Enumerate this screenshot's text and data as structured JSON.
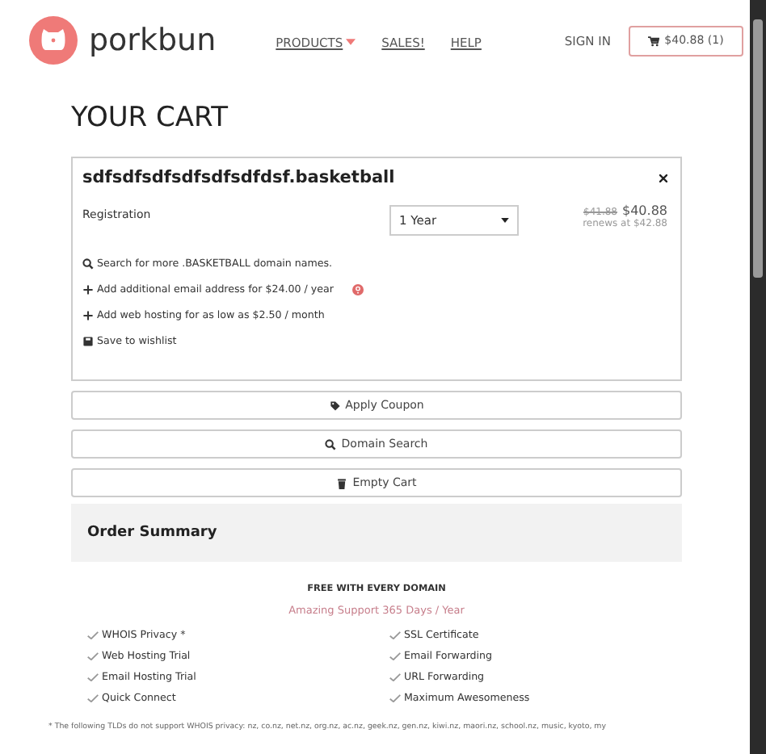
{
  "header": {
    "brand": "porkbun",
    "nav": [
      {
        "label": "PRODUCTS",
        "dropdown": true
      },
      {
        "label": "SALES!",
        "dropdown": false
      },
      {
        "label": "HELP",
        "dropdown": false
      }
    ],
    "sign_in": "SIGN IN",
    "cart_button": "$40.88 (1)"
  },
  "title": "YOUR CART",
  "cart_item": {
    "domain": "sdfsdfsdfsdfsdfsdfdsf.basketball",
    "label": "Registration",
    "term": "1 Year",
    "old_price": "$41.88",
    "price": "$40.88",
    "renewal": "renews at $42.88",
    "links": [
      {
        "kind": "search",
        "text": "Search for more .BASKETBALL domain names.",
        "help": false
      },
      {
        "kind": "add",
        "text": "Add additional email address for $24.00 / year",
        "help": true
      },
      {
        "kind": "add",
        "text": "Add web hosting for as low as $2.50 / month",
        "help": false
      },
      {
        "kind": "save",
        "text": "Save to wishlist",
        "help": false
      }
    ]
  },
  "buttons": [
    {
      "kind": "tag",
      "label": "Apply Coupon"
    },
    {
      "kind": "search",
      "label": "Domain Search"
    },
    {
      "kind": "trash",
      "label": "Empty Cart"
    }
  ],
  "summary": {
    "title": "Order Summary",
    "free_heading": "FREE WITH EVERY DOMAIN",
    "support": "Amazing Support 365 Days / Year",
    "features": [
      "WHOIS Privacy *",
      "SSL Certificate",
      "Web Hosting Trial",
      "Email Forwarding",
      "Email Hosting Trial",
      "URL Forwarding",
      "Quick Connect",
      "Maximum Awesomeness"
    ],
    "footnote": "* The following TLDs do not support WHOIS privacy: nz, co.nz, net.nz, org.nz, ac.nz, geek.nz, gen.nz, kiwi.nz, maori.nz, school.nz, music, kyoto, my"
  }
}
